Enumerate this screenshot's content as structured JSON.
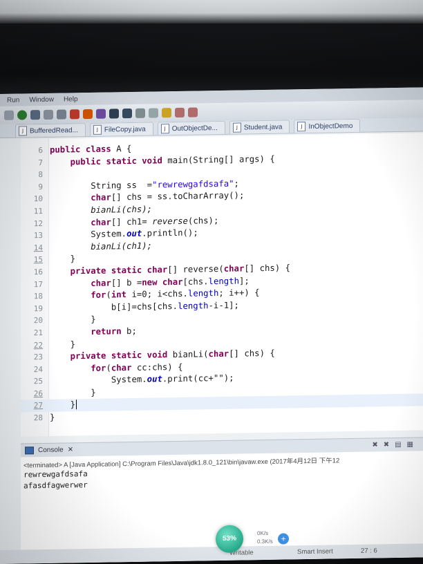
{
  "menu": {
    "items": [
      "Run",
      "Window",
      "Help"
    ]
  },
  "tabs": [
    {
      "label": "BufferedRead..."
    },
    {
      "label": "FileCopy.java"
    },
    {
      "label": "OutObjectDe..."
    },
    {
      "label": "Student.java"
    },
    {
      "label": "InObjectDemo"
    }
  ],
  "editor": {
    "lines": [
      {
        "num": "6"
      },
      {
        "num": "7"
      },
      {
        "num": "8"
      },
      {
        "num": "9"
      },
      {
        "num": "10"
      },
      {
        "num": "11"
      },
      {
        "num": "12"
      },
      {
        "num": "13"
      },
      {
        "num": "14"
      },
      {
        "num": "15"
      },
      {
        "num": "16"
      },
      {
        "num": "17"
      },
      {
        "num": "18"
      },
      {
        "num": "19"
      },
      {
        "num": "20"
      },
      {
        "num": "21"
      },
      {
        "num": "22"
      },
      {
        "num": "23"
      },
      {
        "num": "24"
      },
      {
        "num": "25"
      },
      {
        "num": "26"
      },
      {
        "num": "27"
      },
      {
        "num": "28"
      }
    ],
    "code": {
      "l6a": "public class",
      "l6b": " A {",
      "l7a": "public static void",
      "l7b": " main(String[] args) {",
      "l9a": "String ss  =",
      "l9b": "\"rewrewgafdsafa\"",
      "l9c": ";",
      "l10a": "char",
      "l10b": "[] chs = ss.toCharArray();",
      "l11": "bianLi(chs);",
      "l12a": "char",
      "l12b": "[] ch1= ",
      "l12c": "reverse",
      "l12d": "(chs);",
      "l13a": "System.",
      "l13b": "out",
      "l13c": ".println();",
      "l14": "bianLi(ch1);",
      "l15": "}",
      "l16a": "private static char",
      "l16b": "[] reverse(",
      "l16c": "char",
      "l16d": "[] chs) {",
      "l17a": "char",
      "l17b": "[] b =",
      "l17c": "new char",
      "l17d": "[chs.",
      "l17e": "length",
      "l17f": "];",
      "l18a": "for",
      "l18b": "(",
      "l18c": "int",
      "l18d": " i=0; i<chs.",
      "l18e": "length",
      "l18f": "; i++) {",
      "l19a": "b[i]=chs[chs.",
      "l19b": "length",
      "l19c": "-i-1];",
      "l20": "}",
      "l21a": "return",
      "l21b": " b;",
      "l22": "}",
      "l23a": "private static void",
      "l23b": " bianLi(",
      "l23c": "char",
      "l23d": "[] chs) {",
      "l24a": "for",
      "l24b": "(",
      "l24c": "char",
      "l24d": " cc:chs) {",
      "l25a": "System.",
      "l25b": "out",
      "l25c": ".print(cc+\"\");",
      "l26": "}",
      "l27": "}",
      "l28": "}"
    }
  },
  "console": {
    "tab_label": "Console",
    "terminated": "<terminated> A [Java Application] C:\\Program Files\\Java\\jdk1.8.0_121\\bin\\javaw.exe (2017年4月12日 下午12",
    "output": [
      "rewrewgafdsafa",
      "afasdfagwerwer"
    ]
  },
  "status": {
    "writable": "Writable",
    "insert_mode": "Smart Insert",
    "position": "27 : 6"
  },
  "network_widget": {
    "percent": "53%",
    "up": "0K/s",
    "down": "0.3K/s"
  },
  "colors": {
    "keyword": "#7f0055",
    "string": "#2a00ff",
    "field": "#0000c0",
    "current_line": "#e8f1fb"
  }
}
